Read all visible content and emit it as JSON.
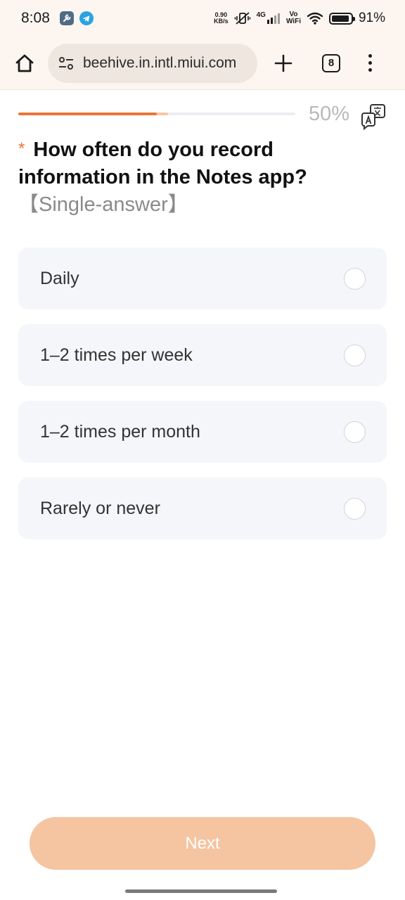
{
  "status_bar": {
    "time": "8:08",
    "net_speed_value": "0.90",
    "net_speed_unit": "KB/s",
    "network": "4G",
    "vowifi_top": "Vo",
    "vowifi_bottom": "WiFi",
    "battery_level": 0.91,
    "battery_text": "91%",
    "icons": [
      "tools-app-icon",
      "telegram-icon",
      "mute-vibrate-icon",
      "signal-icon",
      "wifi-icon",
      "battery-icon"
    ]
  },
  "browser": {
    "url": "beehive.in.intl.miui.com",
    "tab_count": "8",
    "icons": [
      "home-icon",
      "site-settings-icon",
      "plus-icon",
      "tabs-icon",
      "more-menu-icon"
    ]
  },
  "survey": {
    "progress": {
      "value": 0.5,
      "buffer": 0.54,
      "label": "50%",
      "fill_color": "#e8763b"
    },
    "question": {
      "required_mark": "*",
      "text": "How often do you record information in the Notes app?",
      "type_label": "【Single-answer】"
    },
    "options": [
      {
        "label": "Daily",
        "selected": false
      },
      {
        "label": "1–2 times per week",
        "selected": false
      },
      {
        "label": "1–2 times per month",
        "selected": false
      },
      {
        "label": "Rarely or never",
        "selected": false
      }
    ],
    "next_label": "Next",
    "next_color": "#f5c4a1"
  }
}
